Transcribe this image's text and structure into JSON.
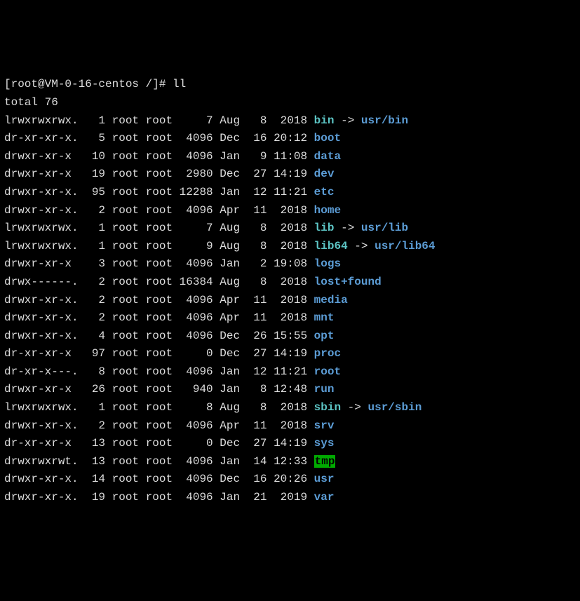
{
  "prompt": "[root@VM-0-16-centos /]# ",
  "command": "ll",
  "total": "total 76",
  "rows": [
    {
      "perm": "lrwxrwxrwx.",
      "links": "  1",
      "owner": "root",
      "group": "root",
      "size": "    7",
      "month": "Aug",
      "day": "  8",
      "time": " 2018",
      "name": "bin",
      "type": "link",
      "target": "usr/bin"
    },
    {
      "perm": "dr-xr-xr-x.",
      "links": "  5",
      "owner": "root",
      "group": "root",
      "size": " 4096",
      "month": "Dec",
      "day": " 16",
      "time": "20:12",
      "name": "boot",
      "type": "dir"
    },
    {
      "perm": "drwxr-xr-x ",
      "links": " 10",
      "owner": "root",
      "group": "root",
      "size": " 4096",
      "month": "Jan",
      "day": "  9",
      "time": "11:08",
      "name": "data",
      "type": "dir"
    },
    {
      "perm": "drwxr-xr-x ",
      "links": " 19",
      "owner": "root",
      "group": "root",
      "size": " 2980",
      "month": "Dec",
      "day": " 27",
      "time": "14:19",
      "name": "dev",
      "type": "dir"
    },
    {
      "perm": "drwxr-xr-x.",
      "links": " 95",
      "owner": "root",
      "group": "root",
      "size": "12288",
      "month": "Jan",
      "day": " 12",
      "time": "11:21",
      "name": "etc",
      "type": "dir"
    },
    {
      "perm": "drwxr-xr-x.",
      "links": "  2",
      "owner": "root",
      "group": "root",
      "size": " 4096",
      "month": "Apr",
      "day": " 11",
      "time": " 2018",
      "name": "home",
      "type": "dir"
    },
    {
      "perm": "lrwxrwxrwx.",
      "links": "  1",
      "owner": "root",
      "group": "root",
      "size": "    7",
      "month": "Aug",
      "day": "  8",
      "time": " 2018",
      "name": "lib",
      "type": "link",
      "target": "usr/lib"
    },
    {
      "perm": "lrwxrwxrwx.",
      "links": "  1",
      "owner": "root",
      "group": "root",
      "size": "    9",
      "month": "Aug",
      "day": "  8",
      "time": " 2018",
      "name": "lib64",
      "type": "link",
      "target": "usr/lib64"
    },
    {
      "perm": "drwxr-xr-x ",
      "links": "  3",
      "owner": "root",
      "group": "root",
      "size": " 4096",
      "month": "Jan",
      "day": "  2",
      "time": "19:08",
      "name": "logs",
      "type": "dir"
    },
    {
      "perm": "drwx------.",
      "links": "  2",
      "owner": "root",
      "group": "root",
      "size": "16384",
      "month": "Aug",
      "day": "  8",
      "time": " 2018",
      "name": "lost+found",
      "type": "dir"
    },
    {
      "perm": "drwxr-xr-x.",
      "links": "  2",
      "owner": "root",
      "group": "root",
      "size": " 4096",
      "month": "Apr",
      "day": " 11",
      "time": " 2018",
      "name": "media",
      "type": "dir"
    },
    {
      "perm": "drwxr-xr-x.",
      "links": "  2",
      "owner": "root",
      "group": "root",
      "size": " 4096",
      "month": "Apr",
      "day": " 11",
      "time": " 2018",
      "name": "mnt",
      "type": "dir"
    },
    {
      "perm": "drwxr-xr-x.",
      "links": "  4",
      "owner": "root",
      "group": "root",
      "size": " 4096",
      "month": "Dec",
      "day": " 26",
      "time": "15:55",
      "name": "opt",
      "type": "dir"
    },
    {
      "perm": "dr-xr-xr-x ",
      "links": " 97",
      "owner": "root",
      "group": "root",
      "size": "    0",
      "month": "Dec",
      "day": " 27",
      "time": "14:19",
      "name": "proc",
      "type": "dir"
    },
    {
      "perm": "dr-xr-x---.",
      "links": "  8",
      "owner": "root",
      "group": "root",
      "size": " 4096",
      "month": "Jan",
      "day": " 12",
      "time": "11:21",
      "name": "root",
      "type": "dir"
    },
    {
      "perm": "drwxr-xr-x ",
      "links": " 26",
      "owner": "root",
      "group": "root",
      "size": "  940",
      "month": "Jan",
      "day": "  8",
      "time": "12:48",
      "name": "run",
      "type": "dir"
    },
    {
      "perm": "lrwxrwxrwx.",
      "links": "  1",
      "owner": "root",
      "group": "root",
      "size": "    8",
      "month": "Aug",
      "day": "  8",
      "time": " 2018",
      "name": "sbin",
      "type": "link",
      "target": "usr/sbin"
    },
    {
      "perm": "drwxr-xr-x.",
      "links": "  2",
      "owner": "root",
      "group": "root",
      "size": " 4096",
      "month": "Apr",
      "day": " 11",
      "time": " 2018",
      "name": "srv",
      "type": "dir"
    },
    {
      "perm": "dr-xr-xr-x ",
      "links": " 13",
      "owner": "root",
      "group": "root",
      "size": "    0",
      "month": "Dec",
      "day": " 27",
      "time": "14:19",
      "name": "sys",
      "type": "dir"
    },
    {
      "perm": "drwxrwxrwt.",
      "links": " 13",
      "owner": "root",
      "group": "root",
      "size": " 4096",
      "month": "Jan",
      "day": " 14",
      "time": "12:33",
      "name": "tmp",
      "type": "sticky"
    },
    {
      "perm": "drwxr-xr-x.",
      "links": " 14",
      "owner": "root",
      "group": "root",
      "size": " 4096",
      "month": "Dec",
      "day": " 16",
      "time": "20:26",
      "name": "usr",
      "type": "dir"
    },
    {
      "perm": "drwxr-xr-x.",
      "links": " 19",
      "owner": "root",
      "group": "root",
      "size": " 4096",
      "month": "Jan",
      "day": " 21",
      "time": " 2019",
      "name": "var",
      "type": "dir"
    }
  ]
}
